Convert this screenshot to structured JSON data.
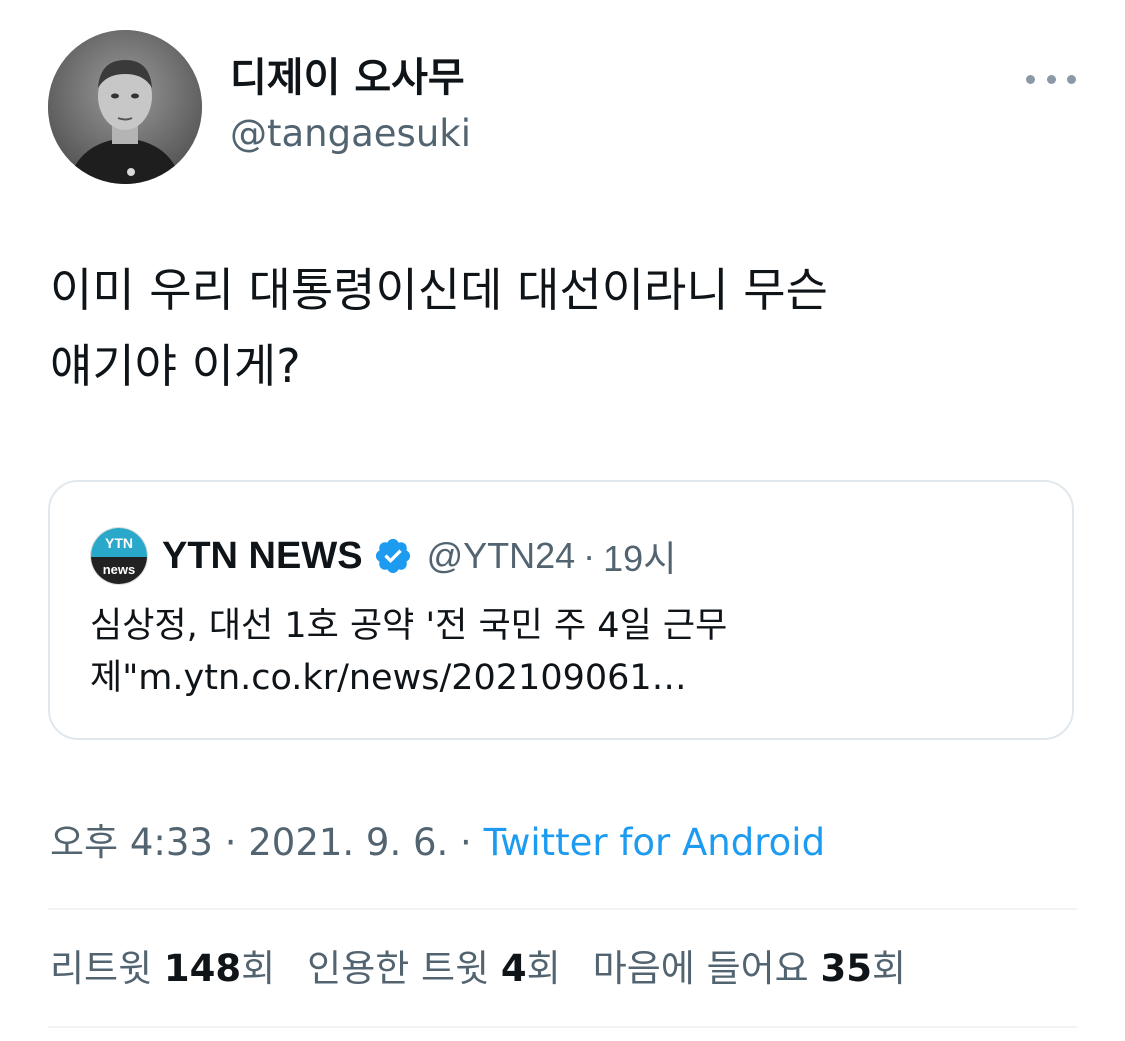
{
  "author": {
    "display_name": "디제이 오사무",
    "handle": "@tangaesuki",
    "avatar_icon": "profile-photo"
  },
  "tweet": {
    "text_line1": "이미 우리 대통령이신데 대선이라니 무슨",
    "text_line2": "얘기야 이게?"
  },
  "quote": {
    "logo_top": "YTN",
    "logo_bottom": "news",
    "name": "YTN NEWS",
    "verified_icon": "verified-badge-icon",
    "handle": "@YTN24",
    "separator": "·",
    "time": "19시",
    "text_line1": "심상정, 대선 1호 공약 '전 국민 주 4일 근무",
    "text_line2": "제\"m.ytn.co.kr/news/202109061…"
  },
  "meta": {
    "time": "오후 4:33",
    "sep1": " · ",
    "date": "2021. 9. 6.",
    "sep2": " · ",
    "source": "Twitter for Android"
  },
  "stats": {
    "retweets_label": "리트윗 ",
    "retweets_count": "148",
    "retweets_suffix": "회",
    "quotes_label": "인용한 트윗 ",
    "quotes_count": "4",
    "quotes_suffix": "회",
    "likes_label": "마음에 들어요 ",
    "likes_count": "35",
    "likes_suffix": "회"
  },
  "colors": {
    "link": "#1d9bf0",
    "secondary_text": "#536471",
    "primary_text": "#0f1419",
    "verified": "#1d9bf0",
    "ytn_blue": "#2aa8c9"
  }
}
